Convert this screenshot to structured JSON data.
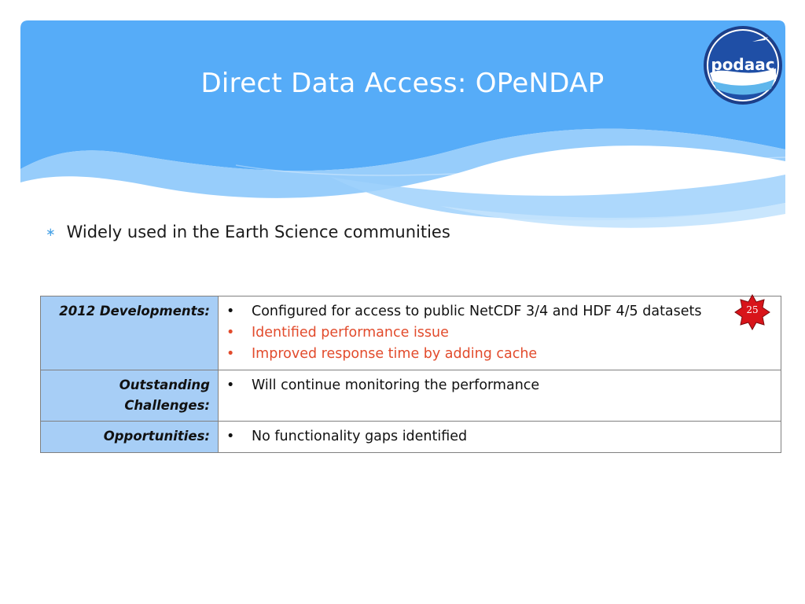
{
  "slide": {
    "title": "Direct Data Access:  OPeNDAP",
    "bullet": "Widely used in the Earth Science communities",
    "bullet_mark": "∗",
    "page_number": "25",
    "logo_text": "podaac"
  },
  "table": {
    "rows": [
      {
        "label": "2012 Developments:",
        "items": [
          {
            "text": "Configured for access to public NetCDF 3/4 and HDF 4/5 datasets",
            "color": "#111111"
          },
          {
            "text": "Identified performance issue",
            "color": "#e24b2c"
          },
          {
            "text": "Improved response time by adding cache",
            "color": "#e24b2c"
          }
        ]
      },
      {
        "label": "Outstanding Challenges:",
        "label_line1": "Outstanding",
        "label_line2": "Challenges:",
        "items": [
          {
            "text": "Will continue monitoring the performance",
            "color": "#111111"
          }
        ]
      },
      {
        "label": "Opportunities:",
        "items": [
          {
            "text": "No functionality gaps identified",
            "color": "#111111"
          }
        ]
      }
    ],
    "bullet_glyph": "•"
  },
  "colors": {
    "header_blue": "#5aaef8",
    "label_fill": "#a7cef6",
    "highlight_red": "#e24b2c",
    "badge_red": "#d8141a"
  }
}
